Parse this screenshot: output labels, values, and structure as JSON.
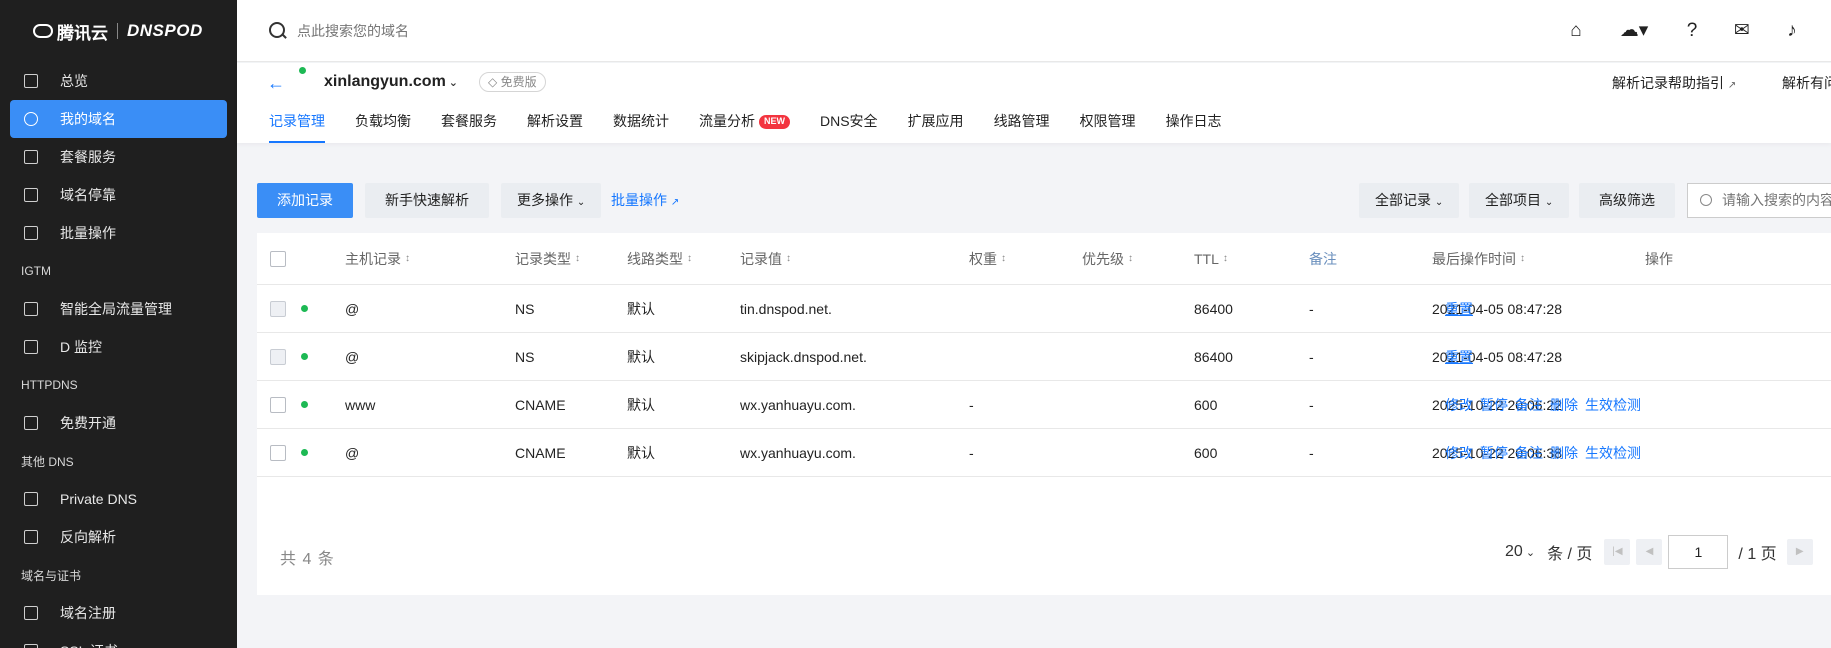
{
  "sidebar": {
    "logo_cn": "腾讯云",
    "logo_en": "DNSPOD",
    "items": [
      {
        "label": "总览",
        "icon": "dashboard-icon",
        "type": "item"
      },
      {
        "label": "我的域名",
        "icon": "globe-icon",
        "type": "item",
        "active": true
      },
      {
        "label": "套餐服务",
        "icon": "package-icon",
        "type": "item"
      },
      {
        "label": "域名停靠",
        "icon": "parking-icon",
        "type": "item"
      },
      {
        "label": "批量操作",
        "icon": "batch-icon",
        "type": "item"
      },
      {
        "label": "IGTM",
        "type": "group"
      },
      {
        "label": "智能全局流量管理",
        "icon": "traffic-icon",
        "type": "item"
      },
      {
        "label": "D 监控",
        "icon": "monitor-icon",
        "type": "item"
      },
      {
        "label": "HTTPDNS",
        "type": "group"
      },
      {
        "label": "免费开通",
        "icon": "activate-icon",
        "type": "item"
      },
      {
        "label": "其他 DNS",
        "type": "group"
      },
      {
        "label": "Private DNS",
        "icon": "diamond-icon",
        "type": "item"
      },
      {
        "label": "反向解析",
        "icon": "reverse-icon",
        "type": "item"
      },
      {
        "label": "域名与证书",
        "type": "group"
      },
      {
        "label": "域名注册",
        "icon": "register-icon",
        "type": "item"
      },
      {
        "label": "SSL 证书",
        "icon": "certificate-icon",
        "type": "item"
      }
    ]
  },
  "topbar": {
    "search_placeholder": "点此搜索您的域名"
  },
  "domain": {
    "name": "xinlangyun.com",
    "plan_badge": "免费版",
    "help_link": "解析记录帮助指引",
    "help_link2": "解析有问题"
  },
  "tabs": [
    {
      "label": "记录管理",
      "active": true
    },
    {
      "label": "负载均衡"
    },
    {
      "label": "套餐服务"
    },
    {
      "label": "解析设置"
    },
    {
      "label": "数据统计"
    },
    {
      "label": "流量分析",
      "badge": "NEW"
    },
    {
      "label": "DNS安全"
    },
    {
      "label": "扩展应用"
    },
    {
      "label": "线路管理"
    },
    {
      "label": "权限管理"
    },
    {
      "label": "操作日志"
    }
  ],
  "toolbar": {
    "add_record": "添加记录",
    "quick_parse": "新手快速解析",
    "more_ops": "更多操作",
    "batch_ops": "批量操作",
    "all_records": "全部记录",
    "all_items": "全部项目",
    "advanced_filter": "高级筛选",
    "search_placeholder": "请输入搜索的内容"
  },
  "table": {
    "headers": {
      "host": "主机记录",
      "type": "记录类型",
      "line": "线路类型",
      "value": "记录值",
      "weight": "权重",
      "priority": "优先级",
      "ttl": "TTL",
      "remark": "备注",
      "time": "最后操作时间",
      "ops": "操作"
    },
    "rows": [
      {
        "host": "@",
        "type": "NS",
        "line": "默认",
        "value": "tin.dnspod.net.",
        "weight": "",
        "ttl": "86400",
        "remark": "-",
        "time": "2021-04-05 08:47:28",
        "ops": [
          "重置"
        ],
        "disabled": true
      },
      {
        "host": "@",
        "type": "NS",
        "line": "默认",
        "value": "skipjack.dnspod.net.",
        "weight": "",
        "ttl": "86400",
        "remark": "-",
        "time": "2021-04-05 08:47:28",
        "ops": [
          "重置"
        ],
        "disabled": true
      },
      {
        "host": "www",
        "type": "CNAME",
        "line": "默认",
        "value": "wx.yanhuayu.com.",
        "weight": "-",
        "ttl": "600",
        "remark": "-",
        "time": "2025-10-22 20:06:22",
        "ops": [
          "修改",
          "暂停",
          "备注",
          "删除",
          "生效检测"
        ],
        "disabled": false
      },
      {
        "host": "@",
        "type": "CNAME",
        "line": "默认",
        "value": "wx.yanhuayu.com.",
        "weight": "-",
        "ttl": "600",
        "remark": "-",
        "time": "2025-10-22 20:06:38",
        "ops": [
          "修改",
          "暂停",
          "备注",
          "删除",
          "生效检测"
        ],
        "disabled": false
      }
    ]
  },
  "pagination": {
    "total": "共 4 条",
    "page_size": "20",
    "per_page_label": "条 / 页",
    "current_page": "1",
    "total_pages": "/ 1 页"
  },
  "colors": {
    "accent": "#3a8ef6",
    "link": "#1677ff",
    "sidebar_bg": "#1f1f1f",
    "status_green": "#1db954",
    "new_badge": "#f3343f"
  }
}
